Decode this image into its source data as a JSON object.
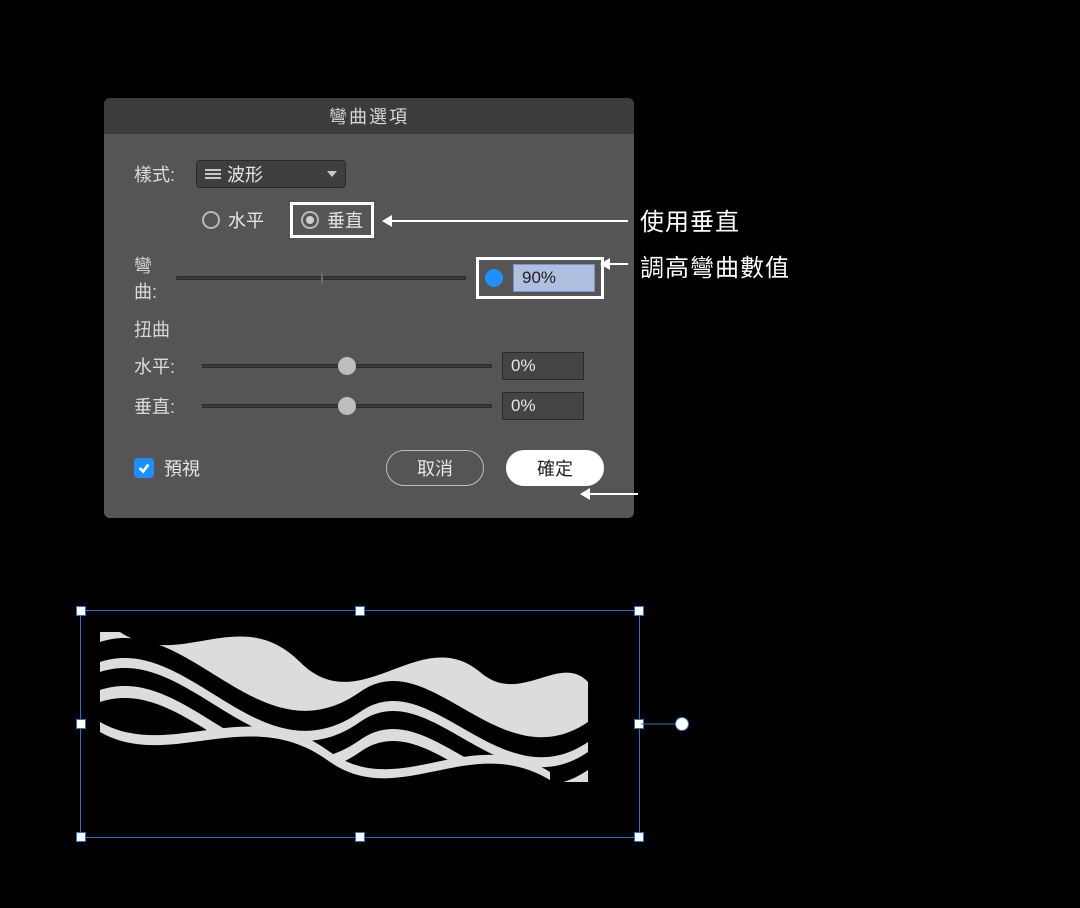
{
  "dialog": {
    "title": "彎曲選項",
    "style_label": "樣式:",
    "style_value": "波形",
    "direction": {
      "horizontal": "水平",
      "vertical": "垂直",
      "selected": "vertical"
    },
    "bend": {
      "label": "彎曲:",
      "value": "90%",
      "knob_percent": 95
    },
    "distortion_label": "扭曲",
    "horizontal": {
      "label": "水平:",
      "value": "0%",
      "knob_percent": 50
    },
    "vertical": {
      "label": "垂直:",
      "value": "0%",
      "knob_percent": 50
    },
    "preview": {
      "label": "預視",
      "checked": true
    },
    "buttons": {
      "cancel": "取消",
      "ok": "確定"
    }
  },
  "annotations": {
    "use_vertical": "使用垂直",
    "increase_bend": "調高彎曲數值"
  }
}
